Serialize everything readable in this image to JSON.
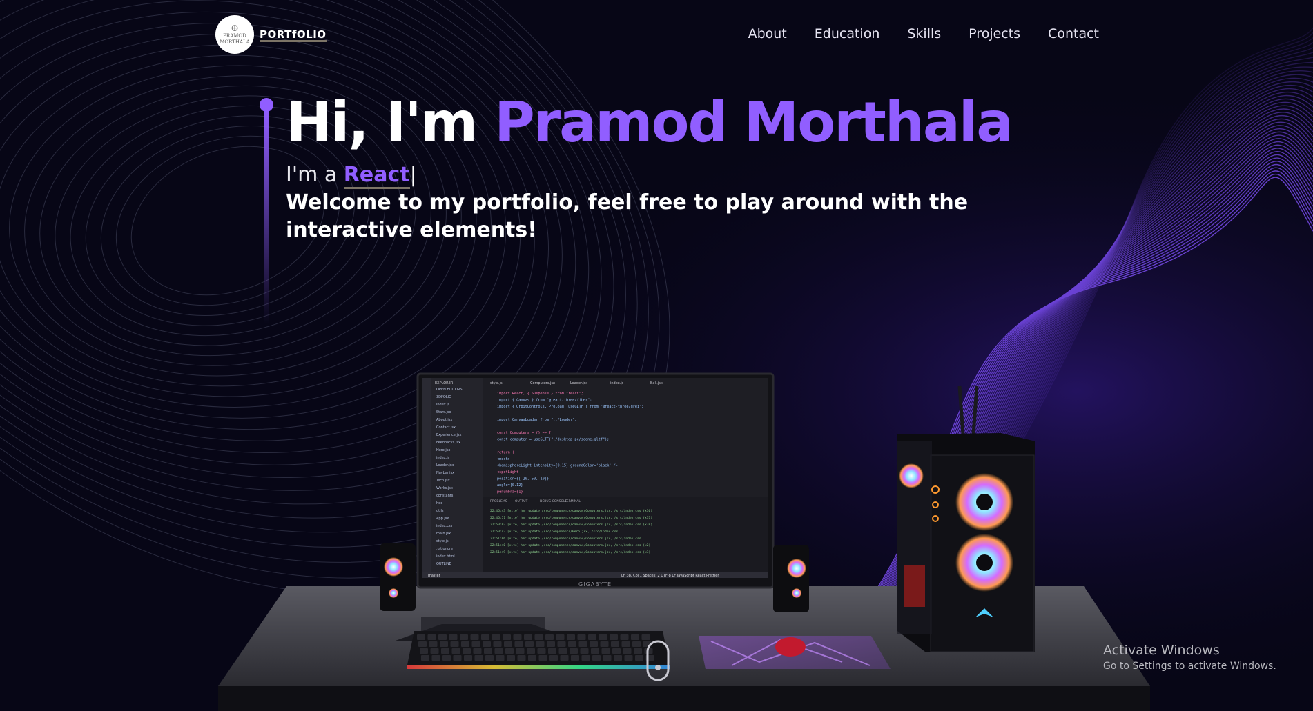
{
  "nav": {
    "logo_text_line1": "PRAMOD",
    "logo_text_line2": "MORTHALA",
    "brand": "PORTfOLIO",
    "links": [
      "About",
      "Education",
      "Skills",
      "Projects",
      "Contact"
    ]
  },
  "hero": {
    "greeting": "Hi, I'm ",
    "name": "Pramod Morthala",
    "typing_prefix": "I'm a ",
    "typing_word": "React",
    "typing_cursor": "|",
    "welcome": "Welcome to my portfolio, feel free to play around with the interactive elements!"
  },
  "monitor": {
    "brand": "GIGABYTE",
    "explorer_title": "EXPLORER",
    "files": [
      "OPEN EDITORS",
      "3DFOLIO",
      "index.js",
      "Stars.jsx",
      "About.jsx",
      "Contact.jsx",
      "Experience.jsx",
      "Feedbacks.jsx",
      "Hero.jsx",
      "index.js",
      "Loader.jsx",
      "Navbar.jsx",
      "Tech.jsx",
      "Works.jsx",
      "constants",
      "hoc",
      "utils",
      "App.jsx",
      "index.css",
      "main.jsx",
      "style.js",
      ".gitignore",
      "index.html",
      "OUTLINE"
    ],
    "tabs": [
      "style.js",
      "Computers.jsx",
      "Loader.jsx",
      "index.js",
      "Ball.jsx"
    ],
    "code_lines": [
      "import React, { Suspense } from \"react\";",
      "import { Canvas } from \"@react-three/fiber\";",
      "import { OrbitControls, Preload, useGLTF } from \"@react-three/drei\";",
      "",
      "import CanvasLoader from \"../Loader\";",
      "",
      "const Computers = () => {",
      "  const computer = useGLTF(\"./desktop_pc/scene.gltf\");",
      "",
      "  return (",
      "    <mesh>",
      "      <hemisphereLight intensity={0.15} groundColor='black' />",
      "      <spotLight",
      "        position={[-20, 50, 10]}",
      "        angle={0.12}",
      "        penumbra={1}"
    ],
    "panel_tabs": [
      "PROBLEMS",
      "OUTPUT",
      "DEBUG CONSOLE",
      "TERMINAL"
    ],
    "terminal_lines": [
      "22:46:43 [vite] hmr update /src/components/canvas/Computers.jsx, /src/index.css (x36)",
      "22:46:51 [vite] hmr update /src/components/canvas/Computers.jsx, /src/index.css (x37)",
      "22:50:02 [vite] hmr update /src/components/canvas/Computers.jsx, /src/index.css (x38)",
      "22:50:42 [vite] hmr update /src/components/Hero.jsx, /src/index.css",
      "22:51:06 [vite] hmr update /src/components/canvas/Computers.jsx, /src/index.css",
      "22:51:40 [vite] hmr update /src/components/canvas/Computers.jsx, /src/index.css (x2)",
      "22:51:49 [vite] hmr update /src/components/canvas/Computers.jsx, /src/index.css (x3)"
    ],
    "status_left": "master",
    "status_right": "Ln 38, Col 1   Spaces: 2   UTF-8   LF   JavaScript React   Prettier"
  },
  "watermark": {
    "line1": "Activate Windows",
    "line2": "Go to Settings to activate Windows."
  },
  "colors": {
    "accent": "#915EFF",
    "background": "#070616",
    "text": "#ffffff"
  }
}
